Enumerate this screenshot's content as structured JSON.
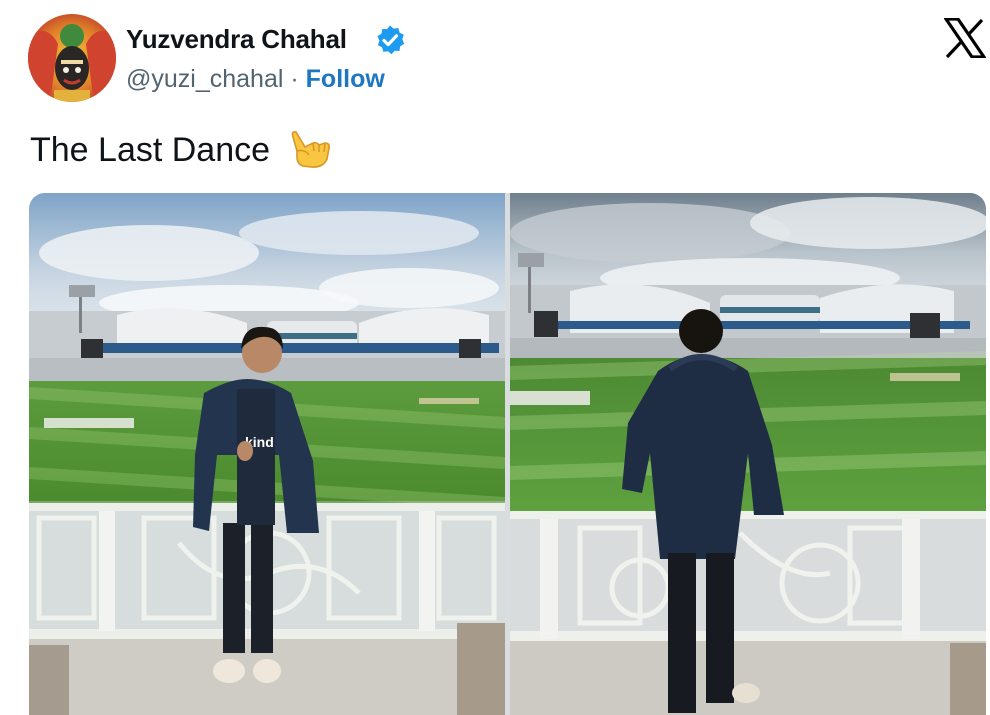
{
  "tweet": {
    "author_name": "Yuzvendra Chahal",
    "handle": "@yuzi_chahal",
    "separator": "·",
    "follow_label": "Follow",
    "text": "The Last Dance",
    "emoji": "call-me-hand",
    "verified": true
  },
  "platform_logo": "x-logo",
  "media": [
    {
      "name": "photo-player-facing-camera",
      "jersey_text": "kind",
      "description_icon": "photo"
    },
    {
      "name": "photo-player-facing-pitch",
      "description_icon": "photo"
    }
  ],
  "colors": {
    "follow": "#1d77c3",
    "verified": "#1d9bf0",
    "text": "#0f1419",
    "secondary": "#536471"
  }
}
